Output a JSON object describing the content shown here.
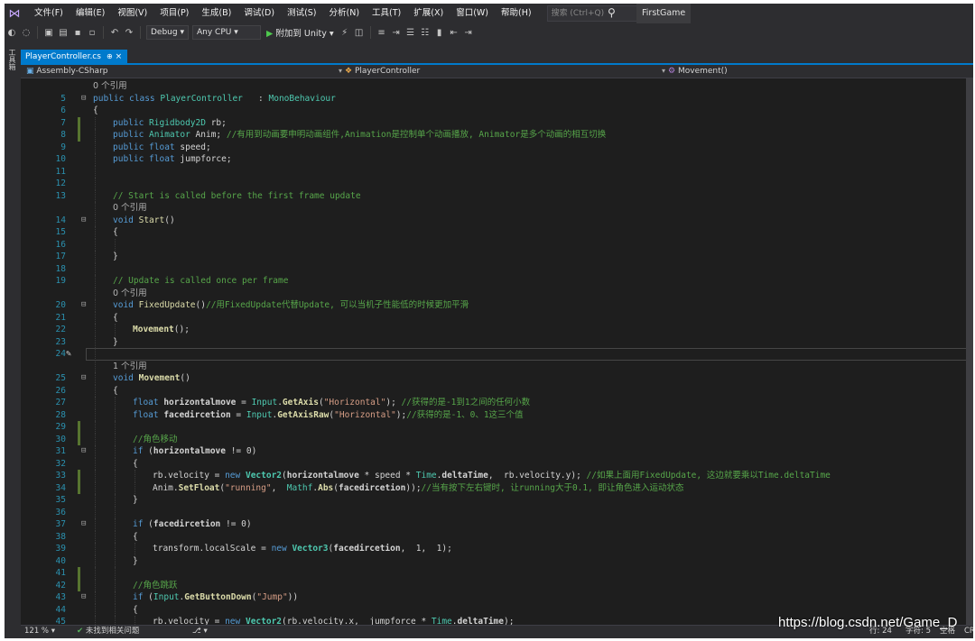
{
  "menubar": {
    "items": [
      "文件(F)",
      "编辑(E)",
      "视图(V)",
      "项目(P)",
      "生成(B)",
      "调试(D)",
      "测试(S)",
      "分析(N)",
      "工具(T)",
      "扩展(X)",
      "窗口(W)",
      "帮助(H)"
    ],
    "search_placeholder": "搜索 (Ctrl+Q)",
    "app_title": "FirstGame"
  },
  "toolbar": {
    "configuration": "Debug",
    "platform": "Any CPU",
    "attach_label": "附加到 Unity"
  },
  "left_strip": {
    "label": "工具箱"
  },
  "tab": {
    "filename": "PlayerController.cs",
    "pin": "⊕",
    "close": "×"
  },
  "navbar": {
    "project": "Assembly-CSharp",
    "class": "PlayerController",
    "member": "Movement()"
  },
  "status": {
    "zoom": "121 %",
    "issues": "未找到相关问题",
    "line": "行: 24",
    "char": "字符: 5",
    "mode": "空格",
    "eol": "CR"
  },
  "watermark": "https://blog.csdn.net/Game_D",
  "colors": {
    "editor_bg": "#1e1e1e",
    "chrome_bg": "#2d2d30",
    "accent": "#007acc",
    "keyword": "#569cd6",
    "type": "#4ec9b0",
    "comment": "#57a64a",
    "string": "#d69d85",
    "line_number": "#2b91af"
  },
  "code_lines": [
    {
      "ln": "",
      "ref": "0 个引用",
      "indent": 0
    },
    {
      "ln": "5",
      "fold": "⊟",
      "indent": 0,
      "t": [
        [
          "kw",
          "public "
        ],
        [
          "kw",
          "class "
        ],
        [
          "ty",
          "PlayerController "
        ],
        [
          "",
          "  : "
        ],
        [
          "ty",
          "MonoBehaviour"
        ]
      ]
    },
    {
      "ln": "6",
      "indent": 0,
      "t": [
        [
          "",
          "{"
        ]
      ]
    },
    {
      "ln": "7",
      "indent": 1,
      "change": true,
      "t": [
        [
          "kw",
          "public "
        ],
        [
          "ty",
          "Rigidbody2D "
        ],
        [
          "",
          "rb;"
        ]
      ]
    },
    {
      "ln": "8",
      "indent": 1,
      "change": true,
      "t": [
        [
          "kw",
          "public "
        ],
        [
          "ty",
          "Animator "
        ],
        [
          "",
          "Anim; "
        ],
        [
          "cm",
          "//有用到动画要申明动画组件,Animation是控制单个动画播放, Animator是多个动画的相互切换"
        ]
      ]
    },
    {
      "ln": "9",
      "indent": 1,
      "t": [
        [
          "kw",
          "public "
        ],
        [
          "kw",
          "float "
        ],
        [
          "",
          "speed;"
        ]
      ]
    },
    {
      "ln": "10",
      "indent": 1,
      "t": [
        [
          "kw",
          "public "
        ],
        [
          "kw",
          "float "
        ],
        [
          "",
          "jumpforce;"
        ]
      ]
    },
    {
      "ln": "11",
      "indent": 1,
      "t": []
    },
    {
      "ln": "12",
      "indent": 1,
      "t": []
    },
    {
      "ln": "13",
      "indent": 1,
      "t": [
        [
          "cm",
          "// Start is called before the first frame update"
        ]
      ]
    },
    {
      "ln": "",
      "ref": "0 个引用",
      "indent": 1
    },
    {
      "ln": "14",
      "fold": "⊟",
      "indent": 1,
      "t": [
        [
          "kw",
          "void "
        ],
        [
          "mt",
          "Start"
        ],
        [
          "",
          "()"
        ]
      ]
    },
    {
      "ln": "15",
      "indent": 1,
      "t": [
        [
          "",
          "{"
        ]
      ]
    },
    {
      "ln": "16",
      "indent": 2,
      "t": []
    },
    {
      "ln": "17",
      "indent": 1,
      "t": [
        [
          "",
          "}"
        ]
      ]
    },
    {
      "ln": "18",
      "indent": 1,
      "t": []
    },
    {
      "ln": "19",
      "indent": 1,
      "t": [
        [
          "cm",
          "// Update is called once per frame"
        ]
      ]
    },
    {
      "ln": "",
      "ref": "0 个引用",
      "indent": 1
    },
    {
      "ln": "20",
      "fold": "⊟",
      "indent": 1,
      "t": [
        [
          "kw",
          "void "
        ],
        [
          "mt",
          "FixedUpdate"
        ],
        [
          "",
          "()"
        ],
        [
          "cm",
          "//用FixedUpdate代替Update, 可以当机子性能低的时候更加平滑"
        ]
      ]
    },
    {
      "ln": "21",
      "indent": 1,
      "t": [
        [
          "",
          "{"
        ]
      ]
    },
    {
      "ln": "22",
      "indent": 2,
      "t": [
        [
          "mt bold",
          "Movement"
        ],
        [
          "",
          "();"
        ]
      ]
    },
    {
      "ln": "23",
      "indent": 1,
      "t": [
        [
          "",
          "}"
        ]
      ]
    },
    {
      "ln": "24",
      "indent": 1,
      "current": true,
      "pencil": true,
      "t": []
    },
    {
      "ln": "",
      "ref": "1 个引用",
      "indent": 1
    },
    {
      "ln": "25",
      "fold": "⊟",
      "indent": 1,
      "t": [
        [
          "kw",
          "void "
        ],
        [
          "mt bold",
          "Movement"
        ],
        [
          "",
          "()"
        ]
      ]
    },
    {
      "ln": "26",
      "indent": 1,
      "t": [
        [
          "",
          "{"
        ]
      ]
    },
    {
      "ln": "27",
      "indent": 2,
      "t": [
        [
          "kw",
          "float "
        ],
        [
          "bold",
          "horizontalmove "
        ],
        [
          "",
          "= "
        ],
        [
          "ty",
          "Input"
        ],
        [
          "",
          "."
        ],
        [
          "mt bold",
          "GetAxis"
        ],
        [
          "",
          "("
        ],
        [
          "st",
          "\"Horizontal\""
        ],
        [
          "",
          "); "
        ],
        [
          "cm",
          "//获得的是-1到1之间的任何小数"
        ]
      ]
    },
    {
      "ln": "28",
      "indent": 2,
      "t": [
        [
          "kw",
          "float "
        ],
        [
          "bold",
          "facedircetion "
        ],
        [
          "",
          "= "
        ],
        [
          "ty",
          "Input"
        ],
        [
          "",
          "."
        ],
        [
          "mt bold",
          "GetAxisRaw"
        ],
        [
          "",
          "("
        ],
        [
          "st",
          "\"Horizontal\""
        ],
        [
          "",
          ");"
        ],
        [
          "cm",
          "//获得的是-1、0、1这三个值"
        ]
      ]
    },
    {
      "ln": "29",
      "indent": 2,
      "change": true,
      "t": []
    },
    {
      "ln": "30",
      "indent": 2,
      "change": true,
      "t": [
        [
          "cm",
          "//角色移动"
        ]
      ]
    },
    {
      "ln": "31",
      "fold": "⊟",
      "indent": 2,
      "t": [
        [
          "kw",
          "if "
        ],
        [
          "",
          "("
        ],
        [
          "bold",
          "horizontalmove "
        ],
        [
          "",
          "!= 0)"
        ]
      ]
    },
    {
      "ln": "32",
      "indent": 2,
      "t": [
        [
          "",
          "{"
        ]
      ]
    },
    {
      "ln": "33",
      "indent": 3,
      "change": true,
      "t": [
        [
          "",
          "rb.velocity = "
        ],
        [
          "kw",
          "new "
        ],
        [
          "ty bold",
          "Vector2"
        ],
        [
          "",
          "("
        ],
        [
          "bold",
          "horizontalmove "
        ],
        [
          "",
          "* speed * "
        ],
        [
          "ty",
          "Time"
        ],
        [
          "",
          "."
        ],
        [
          "bold",
          "deltaTime"
        ],
        [
          "",
          ",  rb.velocity.y); "
        ],
        [
          "cm",
          "//如果上面用FixedUpdate, 这边就要乘以Time.deltaTime"
        ]
      ]
    },
    {
      "ln": "34",
      "indent": 3,
      "change": true,
      "t": [
        [
          "",
          "Anim."
        ],
        [
          "mt bold",
          "SetFloat"
        ],
        [
          "",
          "("
        ],
        [
          "st",
          "\"running\""
        ],
        [
          "",
          ",  "
        ],
        [
          "ty",
          "Mathf"
        ],
        [
          "",
          "."
        ],
        [
          "mt bold",
          "Abs"
        ],
        [
          "",
          "("
        ],
        [
          "bold",
          "facedircetion"
        ],
        [
          "",
          "));"
        ],
        [
          "cm",
          "//当有按下左右键时, 让running大于0.1, 即让角色进入运动状态"
        ]
      ]
    },
    {
      "ln": "35",
      "indent": 2,
      "t": [
        [
          "",
          "}"
        ]
      ]
    },
    {
      "ln": "36",
      "indent": 2,
      "t": []
    },
    {
      "ln": "37",
      "fold": "⊟",
      "indent": 2,
      "t": [
        [
          "kw",
          "if "
        ],
        [
          "",
          "("
        ],
        [
          "bold",
          "facedircetion "
        ],
        [
          "",
          "!= 0)"
        ]
      ]
    },
    {
      "ln": "38",
      "indent": 2,
      "t": [
        [
          "",
          "{"
        ]
      ]
    },
    {
      "ln": "39",
      "indent": 3,
      "t": [
        [
          "",
          "transform.localScale = "
        ],
        [
          "kw",
          "new "
        ],
        [
          "ty bold",
          "Vector3"
        ],
        [
          "",
          "("
        ],
        [
          "bold",
          "facedircetion"
        ],
        [
          "",
          ",  1,  1);"
        ]
      ]
    },
    {
      "ln": "40",
      "indent": 2,
      "t": [
        [
          "",
          "}"
        ]
      ]
    },
    {
      "ln": "41",
      "indent": 2,
      "change": true,
      "t": []
    },
    {
      "ln": "42",
      "indent": 2,
      "change": true,
      "t": [
        [
          "cm",
          "//角色跳跃"
        ]
      ]
    },
    {
      "ln": "43",
      "fold": "⊟",
      "indent": 2,
      "t": [
        [
          "kw",
          "if "
        ],
        [
          "",
          "("
        ],
        [
          "ty",
          "Input"
        ],
        [
          "",
          "."
        ],
        [
          "mt bold",
          "GetButtonDown"
        ],
        [
          "",
          "("
        ],
        [
          "st",
          "\"Jump\""
        ],
        [
          "",
          "))"
        ]
      ]
    },
    {
      "ln": "44",
      "indent": 2,
      "t": [
        [
          "",
          "{"
        ]
      ]
    },
    {
      "ln": "45",
      "indent": 3,
      "t": [
        [
          "",
          "rb.velocity = "
        ],
        [
          "kw",
          "new "
        ],
        [
          "ty bold",
          "Vector2"
        ],
        [
          "",
          "(rb.velocity.x,  jumpforce * "
        ],
        [
          "ty",
          "Time"
        ],
        [
          "",
          "."
        ],
        [
          "bold",
          "deltaTime"
        ],
        [
          "",
          ");"
        ]
      ]
    }
  ]
}
